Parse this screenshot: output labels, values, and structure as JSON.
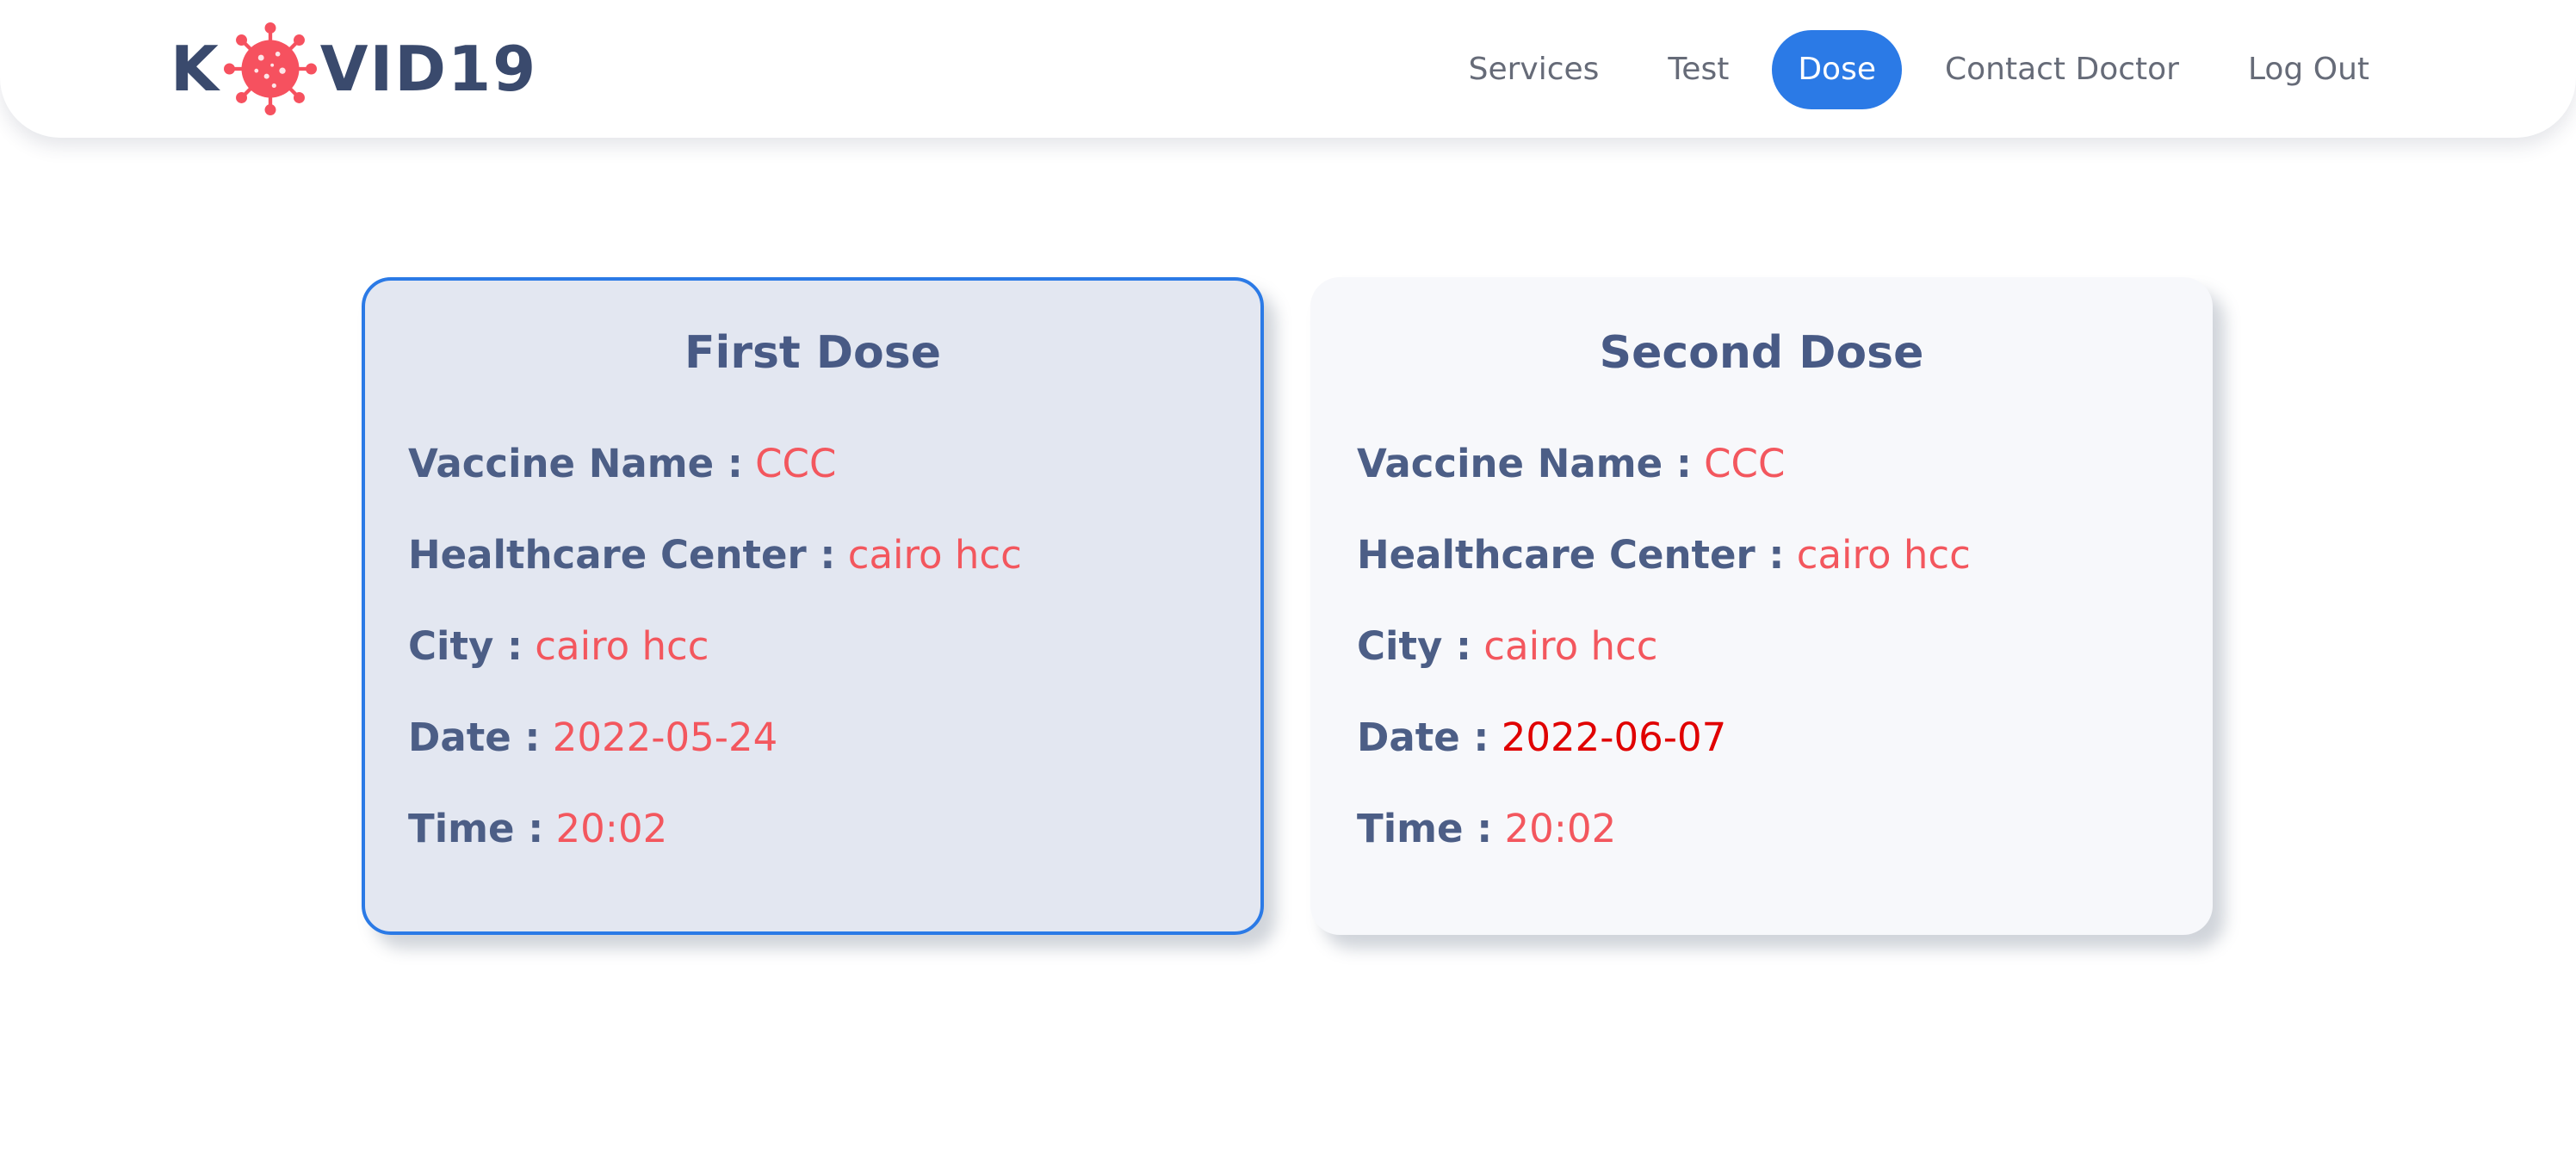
{
  "logo": {
    "prefix": "K",
    "suffix": "VID19",
    "virus_icon": "coronavirus-icon",
    "virus_color": "#f6515f",
    "text_color": "#3a4a6d"
  },
  "nav": {
    "items": [
      {
        "label": "Services"
      },
      {
        "label": "Test"
      },
      {
        "label": "Dose",
        "active": true
      },
      {
        "label": "Contact Doctor"
      },
      {
        "label": "Log Out"
      }
    ],
    "active_color": "#2b7ae6"
  },
  "doses": [
    {
      "title": "First Dose",
      "selected": true,
      "fields": {
        "vaccine_label": "Vaccine Name :",
        "vaccine_value": "CCC",
        "center_label": "Healthcare Center :",
        "center_value": "cairo hcc",
        "city_label": "City :",
        "city_value": "cairo hcc",
        "date_label": "Date :",
        "date_value": "2022-05-24",
        "time_label": "Time :",
        "time_value": "20:02"
      }
    },
    {
      "title": "Second Dose",
      "selected": false,
      "fields": {
        "vaccine_label": "Vaccine Name :",
        "vaccine_value": "CCC",
        "center_label": "Healthcare Center :",
        "center_value": "cairo hcc",
        "city_label": "City :",
        "city_value": "cairo hcc",
        "date_label": "Date :",
        "date_value": "2022-06-07",
        "time_label": "Time :",
        "time_value": "20:02"
      }
    }
  ],
  "colors": {
    "label": "#4c5e86",
    "value": "#f3575e",
    "alert_value": "#e00000",
    "selected_border": "#2b7ae6"
  }
}
